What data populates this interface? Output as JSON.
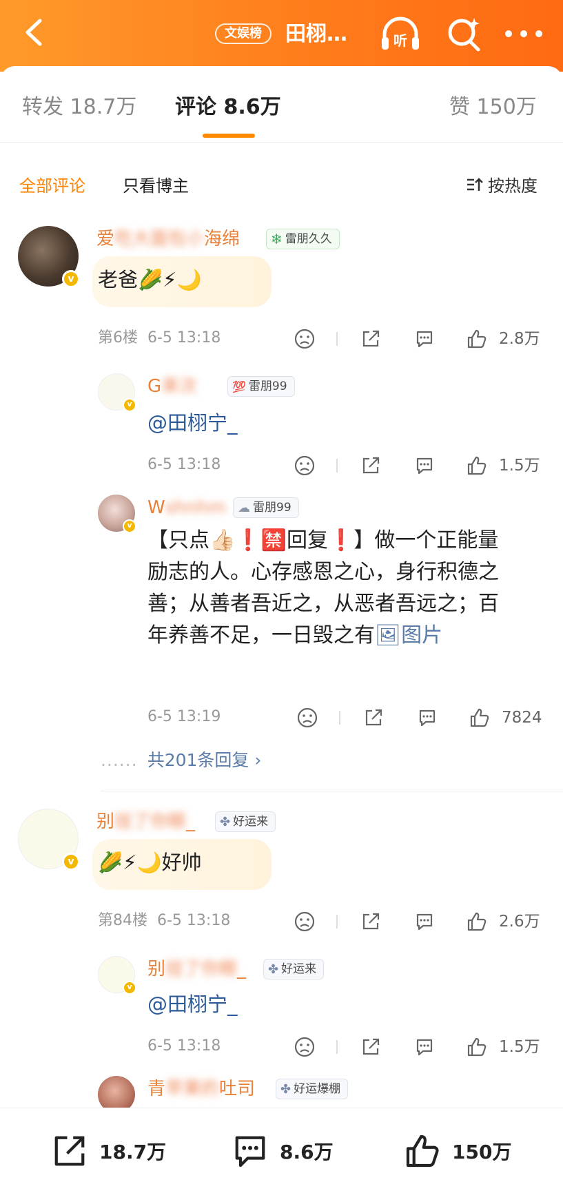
{
  "header": {
    "tag": "文娱榜",
    "title": "田栩…",
    "listen_label": "听"
  },
  "tabs": [
    {
      "label": "转发 18.7万"
    },
    {
      "label": "评论 8.6万"
    },
    {
      "label": "赞 150万"
    }
  ],
  "filter": {
    "all": "全部评论",
    "owner_only": "只看博主",
    "sort": "按热度"
  },
  "comments": [
    {
      "name_visible_start": "爱",
      "name_blurred": "吃大面包小",
      "name_visible_end": "海绵",
      "badge": "雷朋久久",
      "text": "老爸🌽⚡🌙",
      "floor": "第6楼",
      "time": "6-5 13:18",
      "likes": "2.8万"
    },
    {
      "name_visible_start": "G",
      "name_blurred": "来次",
      "name_visible_end": "",
      "badge": "雷朋99",
      "text": "@田栩宁_",
      "time": "6-5 13:18",
      "likes": "1.5万"
    },
    {
      "name_visible_start": "W",
      "name_blurred": "shnhm",
      "name_visible_end": "",
      "badge": "雷朋99",
      "text": "【只点👍🏻❗🈲回复❗】做一个正能量励志的人。心存感恩之心，身行积德之善；从善者吾近之，从恶者吾远之；百年养善不足，一日毁之有",
      "image_link": "图片",
      "time": "6-5 13:19",
      "likes": "7824"
    },
    {
      "name_visible_start": "别",
      "name_blurred": "挂了你眼",
      "name_visible_end": "_",
      "badge": "好运来",
      "text": "🌽⚡🌙好帅",
      "floor": "第84楼",
      "time": "6-5 13:18",
      "likes": "2.6万"
    },
    {
      "name_visible_start": "别",
      "name_blurred": "挂了你眼",
      "name_visible_end": "_",
      "badge": "好运来",
      "text": "@田栩宁_",
      "time": "6-5 13:18",
      "likes": "1.5万"
    },
    {
      "name_visible_start": "青",
      "name_blurred": "苹果的",
      "name_visible_end": "吐司",
      "badge": "好运爆棚"
    }
  ],
  "more_replies": "共201条回复",
  "more_replies_dots": "......",
  "bottom": {
    "repost": "18.7万",
    "comment": "8.6万",
    "like": "150万"
  },
  "colors": {
    "brand_orange": "#ff8200",
    "name_orange": "#e8823a",
    "link_blue": "#5b7ba8"
  }
}
